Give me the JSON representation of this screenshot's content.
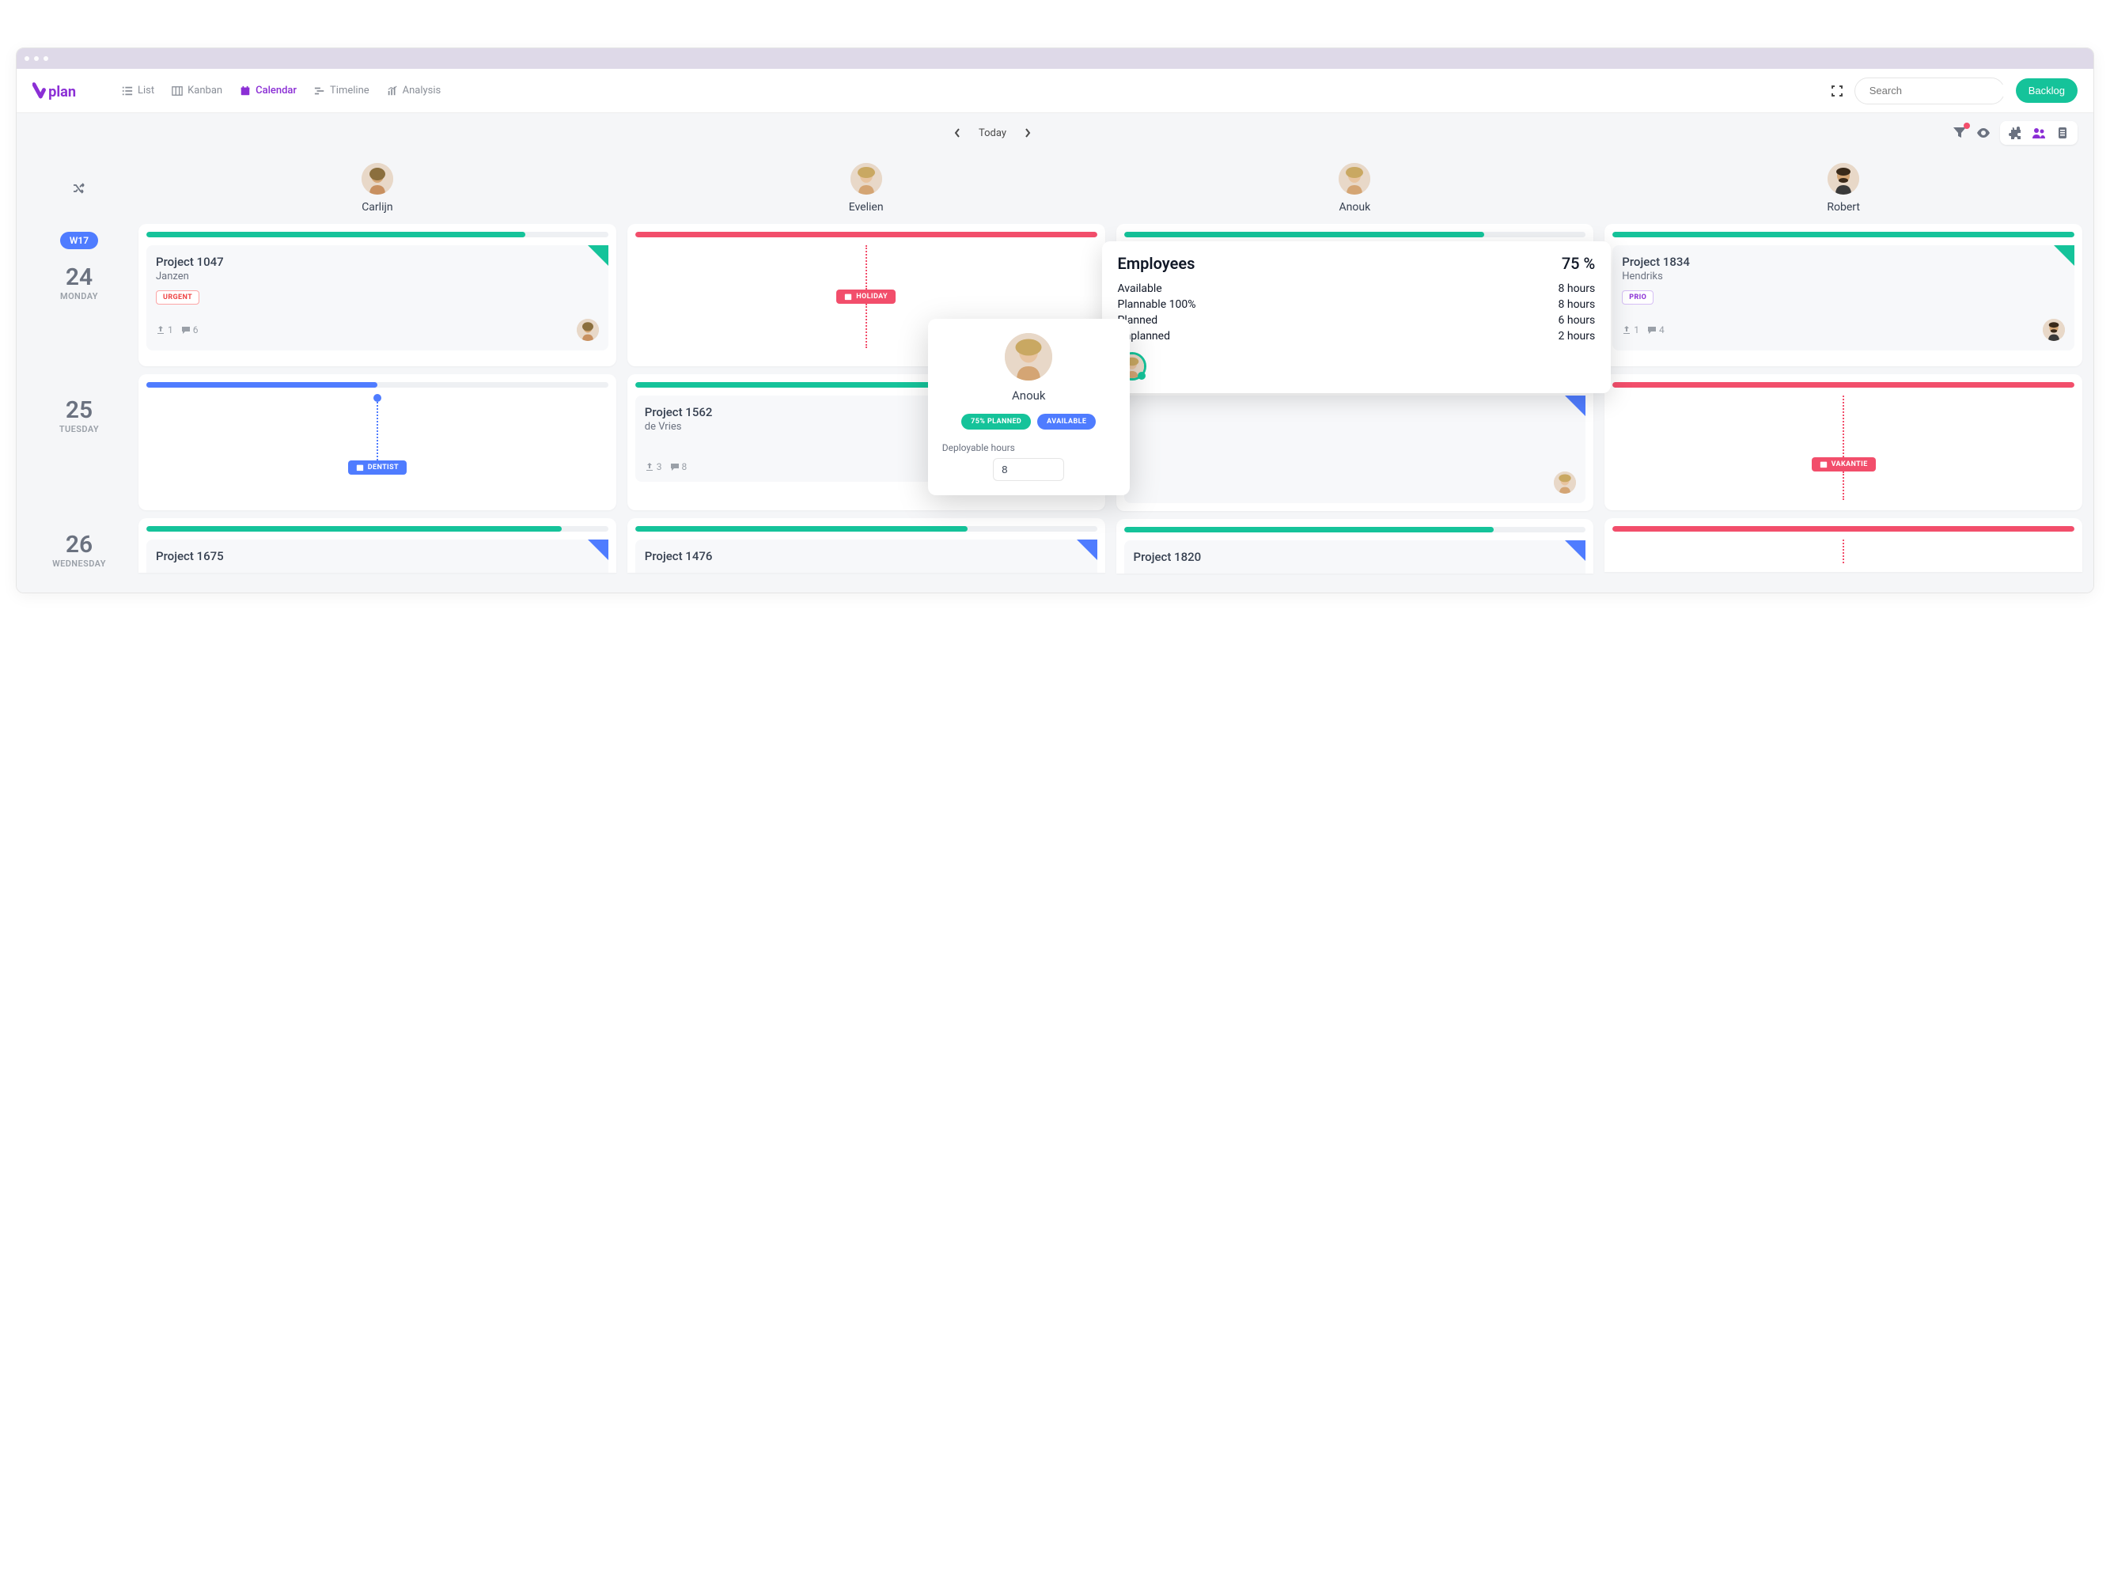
{
  "brand": {
    "name": "vplan",
    "color": "#8b2fd5"
  },
  "views": {
    "list": {
      "label": "List"
    },
    "kanban": {
      "label": "Kanban"
    },
    "calendar": {
      "label": "Calendar",
      "active": true
    },
    "timeline": {
      "label": "Timeline"
    },
    "analysis": {
      "label": "Analysis"
    }
  },
  "search": {
    "placeholder": "Search"
  },
  "backlog": {
    "label": "Backlog"
  },
  "dateNav": {
    "today": "Today"
  },
  "week": {
    "badge": "W17"
  },
  "days": [
    {
      "num": "24",
      "name": "MONDAY"
    },
    {
      "num": "25",
      "name": "TUESDAY"
    },
    {
      "num": "26",
      "name": "WEDNESDAY"
    }
  ],
  "people": {
    "carlijn": {
      "name": "Carlijn"
    },
    "evelien": {
      "name": "Evelien"
    },
    "anouk": {
      "name": "Anouk"
    },
    "robert": {
      "name": "Robert"
    }
  },
  "cards": {
    "p1047": {
      "title": "Project 1047",
      "client": "Janzen",
      "tag": "URGENT",
      "uploads": "1",
      "comments": "6"
    },
    "p1834": {
      "title": "Project 1834",
      "client": "Hendriks",
      "tag": "PRIO",
      "uploads": "1",
      "comments": "4"
    },
    "p1562": {
      "title": "Project 1562",
      "client": "de Vries",
      "uploads": "3",
      "comments": "8"
    },
    "p1675": {
      "title": "Project 1675"
    },
    "p1476": {
      "title": "Project 1476"
    },
    "p1820": {
      "title": "Project 1820"
    }
  },
  "pills": {
    "holiday": "HOLIDAY",
    "dentist": "DENTIST",
    "vakantie": "VAKANTIE"
  },
  "employeesPopover": {
    "title": "Employees",
    "percent": "75 %",
    "rows": [
      {
        "label": "Available",
        "value": "8 hours"
      },
      {
        "label": "Plannable 100%",
        "value": "8 hours"
      },
      {
        "label": "Planned",
        "value": "6 hours"
      },
      {
        "label": "Unplanned",
        "value": "2 hours"
      }
    ]
  },
  "personPopover": {
    "name": "Anouk",
    "plannedPill": "75% PLANNED",
    "availablePill": "AVAILABLE",
    "deployableLabel": "Deployable hours",
    "deployableValue": "8"
  },
  "colors": {
    "accent": "#8b2fd5",
    "green": "#15c39a",
    "pink": "#f24e6b",
    "blue": "#4f7cff"
  }
}
